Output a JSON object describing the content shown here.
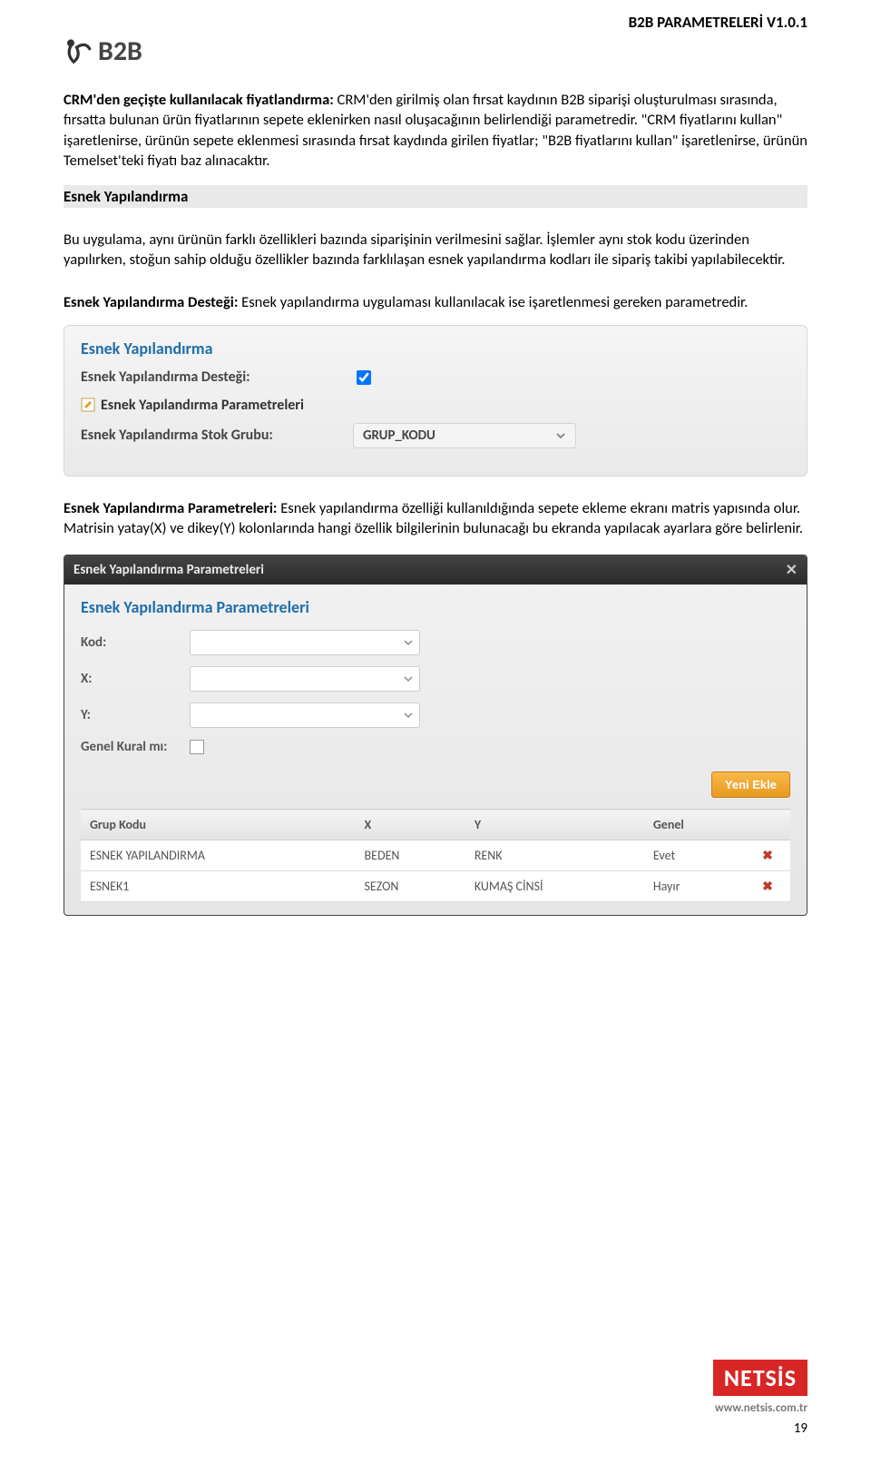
{
  "doc": {
    "title": "B2B PARAMETRELERİ V1.0.1",
    "logo_text": "B2B",
    "page_number": "19"
  },
  "text": {
    "p1_label": "CRM'den geçişte kullanılacak fiyatlandırma:",
    "p1_body": " CRM'den girilmiş olan fırsat kaydının B2B siparişi oluşturulması sırasında, fırsatta bulunan ürün fiyatlarının sepete eklenirken nasıl oluşacağının belirlendiği parametredir. \"CRM fiyatlarını kullan\" işaretlenirse, ürünün sepete eklenmesi sırasında fırsat kaydında girilen fiyatlar; \"B2B fiyatlarını kullan\" işaretlenirse, ürünün Temelset'teki fiyatı baz alınacaktır.",
    "h1": "Esnek Yapılandırma",
    "p2": "Bu uygulama, aynı ürünün farklı özellikleri bazında siparişinin verilmesini sağlar. İşlemler aynı stok kodu üzerinden yapılırken, stoğun sahip olduğu özellikler bazında farklılaşan esnek yapılandırma kodları ile sipariş takibi yapılabilecektir.",
    "p3_label": "Esnek Yapılandırma Desteği:",
    "p3_body": " Esnek yapılandırma uygulaması kullanılacak ise işaretlenmesi gereken parametredir.",
    "p4_label": "Esnek Yapılandırma Parametreleri:",
    "p4_body": " Esnek yapılandırma özelliği kullanıldığında sepete ekleme ekranı matris yapısında olur. Matrisin yatay(X) ve dikey(Y) kolonlarında hangi özellik bilgilerinin bulunacağı bu ekranda yapılacak ayarlara göre belirlenir."
  },
  "panel1": {
    "group_title": "Esnek Yapılandırma",
    "support_label": "Esnek Yapılandırma Desteği:",
    "params_link": "Esnek Yapılandırma Parametreleri",
    "stock_group_label": "Esnek Yapılandırma Stok Grubu:",
    "stock_group_value": "GRUP_KODU"
  },
  "panel2": {
    "titlebar": "Esnek Yapılandırma Parametreleri",
    "group_title": "Esnek Yapılandırma Parametreleri",
    "labels": {
      "kod": "Kod:",
      "x": "X:",
      "y": "Y:",
      "genel": "Genel Kural mı:"
    },
    "button": "Yeni Ekle",
    "columns": {
      "c0": "Grup Kodu",
      "c1": "X",
      "c2": "Y",
      "c3": "Genel"
    },
    "rows": [
      {
        "grup": "ESNEK YAPILANDIRMA",
        "x": "BEDEN",
        "y": "RENK",
        "genel": "Evet"
      },
      {
        "grup": "ESNEK1",
        "x": "SEZON",
        "y": "KUMAŞ CİNSİ",
        "genel": "Hayır"
      }
    ]
  },
  "footer": {
    "brand": "NETSİS",
    "url": "www.netsis.com.tr"
  }
}
